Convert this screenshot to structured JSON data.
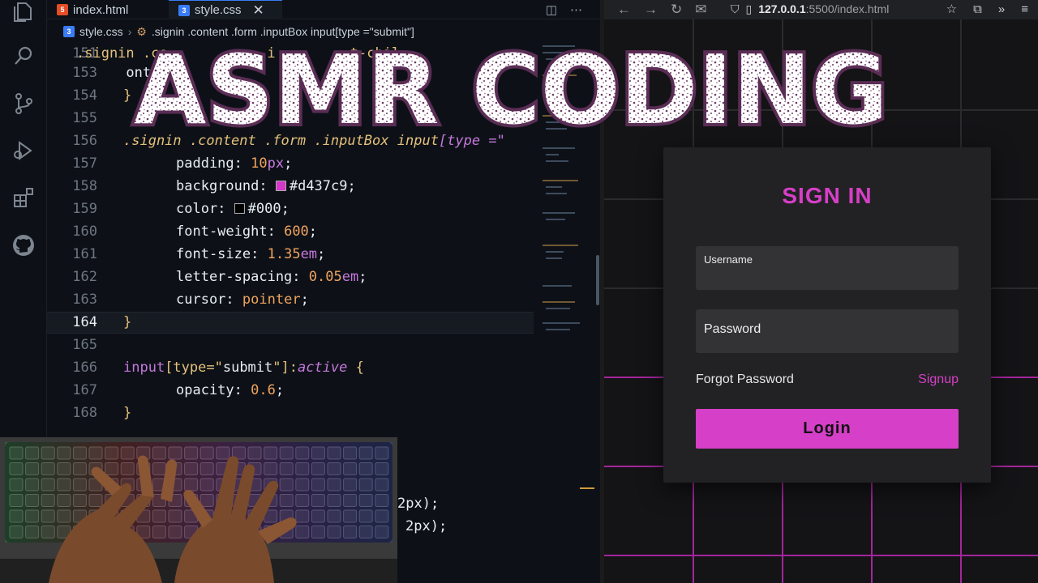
{
  "overlay_title": "ASMR CODING",
  "editor": {
    "tabs": [
      {
        "label": "index.html",
        "icon": "html5-icon",
        "active": false
      },
      {
        "label": "style.css",
        "icon": "css3-icon",
        "active": true
      }
    ],
    "breadcrumb": {
      "file": "style.css",
      "selector": ".signin .content .form .inputBox input[type =\"submit\"]"
    },
    "line_numbers": [
      "151",
      "153",
      "154",
      "155",
      "156",
      "157",
      "158",
      "159",
      "160",
      "161",
      "162",
      "163",
      "164",
      "165",
      "166",
      "167",
      "168"
    ],
    "current_line": "164",
    "code": {
      "l151": ".signin .co           .i         t-chil",
      "l153": "      ont",
      "l154": "}",
      "l156_sel": ".signin .content .form .inputBox input",
      "l156_attr": "[type =\"",
      "l157_prop": "padding",
      "l157_val": "10",
      "l157_unit": "px",
      "l158_prop": "background",
      "l158_val": "#d437c9",
      "l159_prop": "color",
      "l159_val": "#000",
      "l160_prop": "font-weight",
      "l160_val": "600",
      "l161_prop": "font-size",
      "l161_val": "1.35",
      "l161_unit": "em",
      "l162_prop": "letter-spacing",
      "l162_val": "0.05",
      "l162_unit": "em",
      "l163_prop": "cursor",
      "l163_val": "pointer",
      "l164": "}",
      "l166_a": "input",
      "l166_b": "[type=\"",
      "l166_c": "submit",
      "l166_d": "\"]:",
      "l166_e": "active",
      "l167_prop": "opacity",
      "l167_val": "0.6",
      "l168": "}",
      "frag1": "2px);",
      "frag2": "2px);"
    }
  },
  "browser": {
    "url_host": "127.0.0.1",
    "url_path": ":5500/index.html",
    "form": {
      "title": "SIGN IN",
      "username_label": "Username",
      "password_label": "Password",
      "forgot": "Forgot Password",
      "signup": "Signup",
      "login": "Login"
    }
  },
  "colors": {
    "accent": "#d63fc7",
    "swatch_pink": "#d437c9",
    "swatch_black": "#000000"
  }
}
